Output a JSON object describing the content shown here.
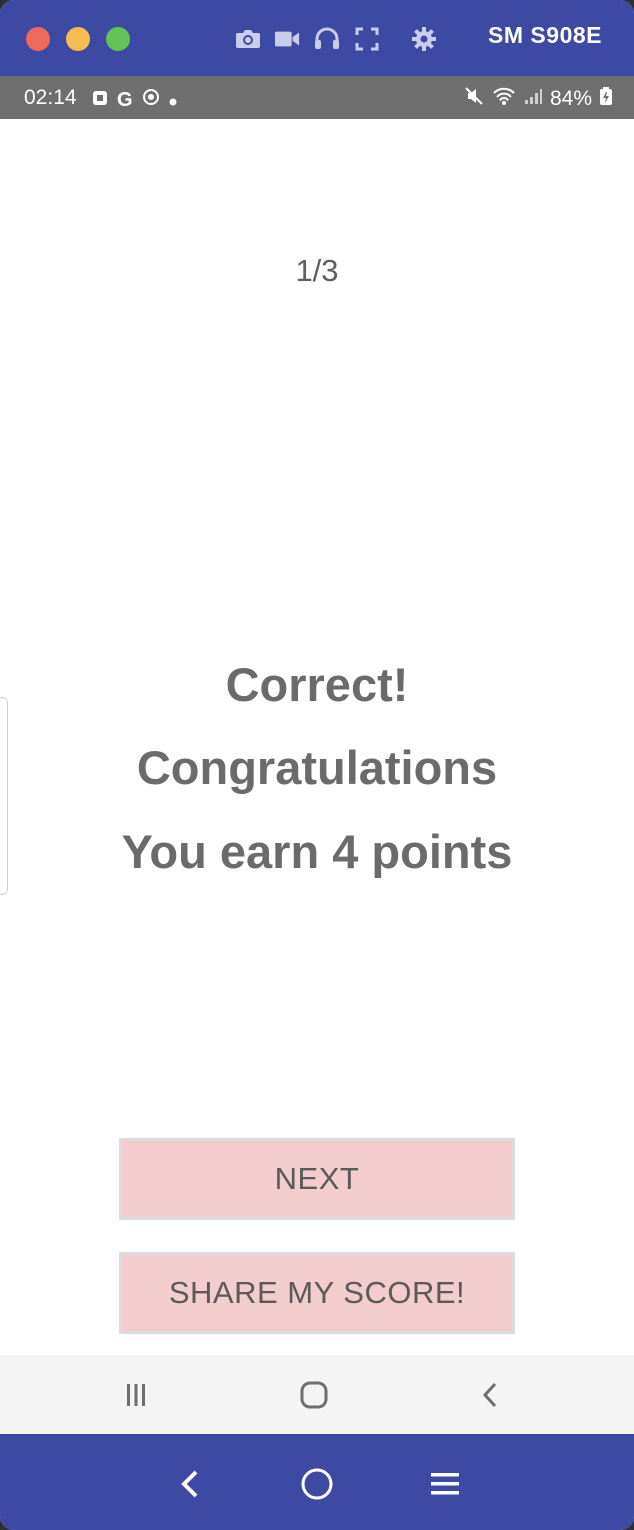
{
  "window": {
    "device_name": "SM S908E",
    "controls": [
      "close",
      "minimize",
      "zoom"
    ],
    "toolbar_icons": [
      "camera-icon",
      "video-icon",
      "headphones-icon",
      "fullscreen-icon",
      "settings-icon"
    ]
  },
  "status_bar": {
    "time": "02:14",
    "left_icons": [
      "notification-icon",
      "google-icon",
      "location-icon",
      "dot-icon"
    ],
    "right_icons": [
      "mute-icon",
      "wifi-icon",
      "signal-icon"
    ],
    "battery": "84%"
  },
  "quiz": {
    "progress": "1/3",
    "result_line1": "Correct!",
    "result_line2": "Congratulations",
    "result_line3": "You earn 4 points",
    "next_label": "NEXT",
    "share_label": "SHARE MY SCORE!"
  },
  "colors": {
    "emulator_bar": "#3c4aa3",
    "status_bar": "#6f6f6f",
    "button_bg": "#f3cdcd",
    "text": "#6b6b6b"
  },
  "nav_bar": {
    "icons": [
      "recents-icon",
      "home-icon",
      "back-icon"
    ]
  },
  "emulator_nav": {
    "icons": [
      "back-icon",
      "home-icon",
      "menu-icon"
    ]
  }
}
